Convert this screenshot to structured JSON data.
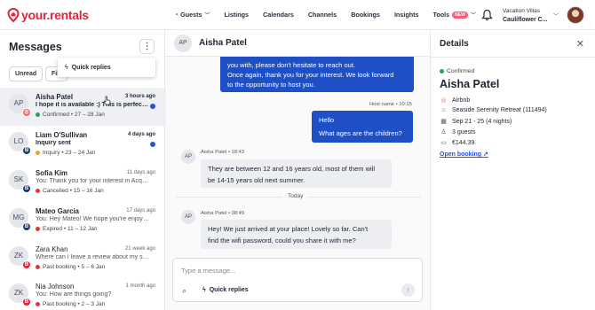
{
  "brand": {
    "name": "your.rentals",
    "color": "#e0243c"
  },
  "nav": [
    {
      "label": "Guests",
      "has_menu": true
    },
    {
      "label": "Listings"
    },
    {
      "label": "Calendars"
    },
    {
      "label": "Channels"
    },
    {
      "label": "Bookings"
    },
    {
      "label": "Insights"
    },
    {
      "label": "Tools",
      "badge": "NEW",
      "has_menu": true
    }
  ],
  "account": {
    "label": "Vacation Villas",
    "name": "Cauliflower C..."
  },
  "messages_panel": {
    "title": "Messages",
    "filters": [
      "Unread",
      "Filt"
    ],
    "dropdown_item": "Quick replies",
    "conversations": [
      {
        "initials": "AP",
        "name": "Aisha Patel",
        "time": "3 hours ago",
        "preview": "I hope it is available :) This is perfect f...",
        "status": "Confirmed",
        "dates": "27 – 28 Jan",
        "status_color": "#2e9e57",
        "channel": "airbnb",
        "unread": true,
        "selected": true
      },
      {
        "initials": "LO",
        "name": "Liam O'Sullivan",
        "time": "4 days ago",
        "preview": "Inquiry sent",
        "status": "Inquiry",
        "dates": "23 – 24 Jan",
        "status_color": "#e8a13a",
        "channel": "booking",
        "unread": true,
        "selected": false
      },
      {
        "initials": "SK",
        "name": "Sofia Kim",
        "time": "11 days ago",
        "preview": "You: Thank you for your interest in Acqua...",
        "status": "Cancelled",
        "dates": "15 – 16 Jan",
        "status_color": "#d83a3a",
        "channel": "booking",
        "unread": false,
        "selected": false
      },
      {
        "initials": "MG",
        "name": "Mateo Garcia",
        "time": "17 days ago",
        "preview": "You: Hey Mateo! We hope you're enjoying...",
        "status": "Expired",
        "dates": "11 – 12 Jan",
        "status_color": "#d83a3a",
        "channel": "booking",
        "unread": false,
        "selected": false
      },
      {
        "initials": "ZK",
        "name": "Zara Khan",
        "time": "21 week ago",
        "preview": "Where can I leave a review about my stay?",
        "status": "Past booking",
        "dates": "5 – 6 Jan",
        "status_color": "#d83a3a",
        "channel": "b2",
        "unread": false,
        "selected": false
      },
      {
        "initials": "ZK",
        "name": "Nia Johnson",
        "time": "1 month ago",
        "preview": "You: How are things going?",
        "status": "Past booking",
        "dates": "2 – 3 Jan",
        "status_color": "#d83a3a",
        "channel": "b2",
        "unread": false,
        "selected": false
      }
    ]
  },
  "chat": {
    "initials": "AP",
    "name": "Aisha Patel",
    "host_message_top": [
      "you with, please don't hesitate to reach out.",
      "Once again, thank you for your interest. We look forward",
      "to the opportunity to host you."
    ],
    "host_meta": "Host name • 10:15",
    "host_message_2": [
      "Hello",
      "What ages are the children?"
    ],
    "guest_msg_1": {
      "sender": "Aisha Patel",
      "time": "18:43",
      "lines": [
        "They are between 12 and 16 years old, most of them will",
        "be 14-15 years old next summer."
      ]
    },
    "divider": "Today",
    "guest_msg_2": {
      "sender": "Aisha Patel",
      "time": "08:49",
      "lines": [
        "Hey! We just arrived at your place! Lovely so far. Can't",
        "find the wifi password, could you share it with me?"
      ]
    },
    "composer": {
      "placeholder": "Type a message...",
      "quick_replies": "Quick replies"
    }
  },
  "details": {
    "title": "Details",
    "status": "Confirmed",
    "guest": "Aisha Patel",
    "rows": [
      {
        "icon": "airbnb-icon",
        "text": "Airbnb"
      },
      {
        "icon": "home-icon",
        "text": "Seaside Serenity Retreat (111494)"
      },
      {
        "icon": "calendar-icon",
        "text": "Sep 21 - 25 (4 nights)"
      },
      {
        "icon": "guests-icon",
        "text": "3 guests"
      },
      {
        "icon": "money-icon",
        "text": "€144.39"
      }
    ],
    "link": "Open booking"
  }
}
